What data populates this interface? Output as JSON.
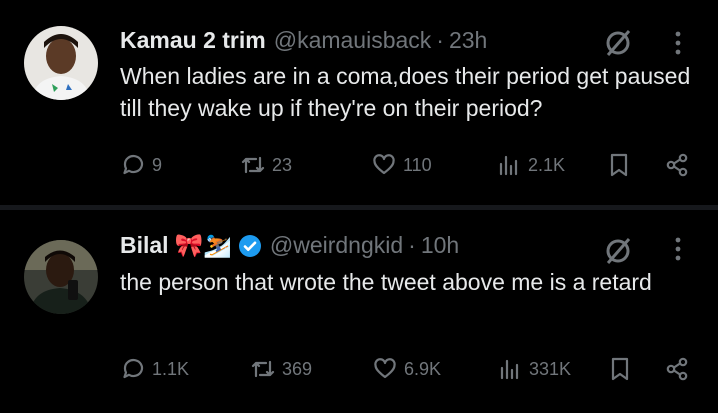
{
  "tweets": [
    {
      "name": "Kamau 2 trim",
      "handle": "@kamauisback",
      "separator": "·",
      "time": "23h",
      "text": "When ladies are in a coma,does their period get paused till they wake up if they're on their period?",
      "stats": {
        "replies": "9",
        "reposts": "23",
        "likes": "110",
        "views": "2.1K"
      }
    },
    {
      "name": "Bilal",
      "name_emojis": "🎀⛷️",
      "verified": true,
      "handle": "@weirdngkid",
      "separator": "·",
      "time": "10h",
      "text": "the person that wrote the tweet above me is a retard",
      "stats": {
        "replies": "1.1K",
        "reposts": "369",
        "likes": "6.9K",
        "views": "331K"
      }
    }
  ],
  "colors": {
    "background": "#000000",
    "text": "#e7e9ea",
    "muted": "#71767b",
    "verified": "#1d9bf0"
  },
  "icons": [
    "reply-icon",
    "repost-icon",
    "like-icon",
    "views-icon",
    "bookmark-icon",
    "share-icon",
    "grok-icon",
    "more-icon"
  ]
}
